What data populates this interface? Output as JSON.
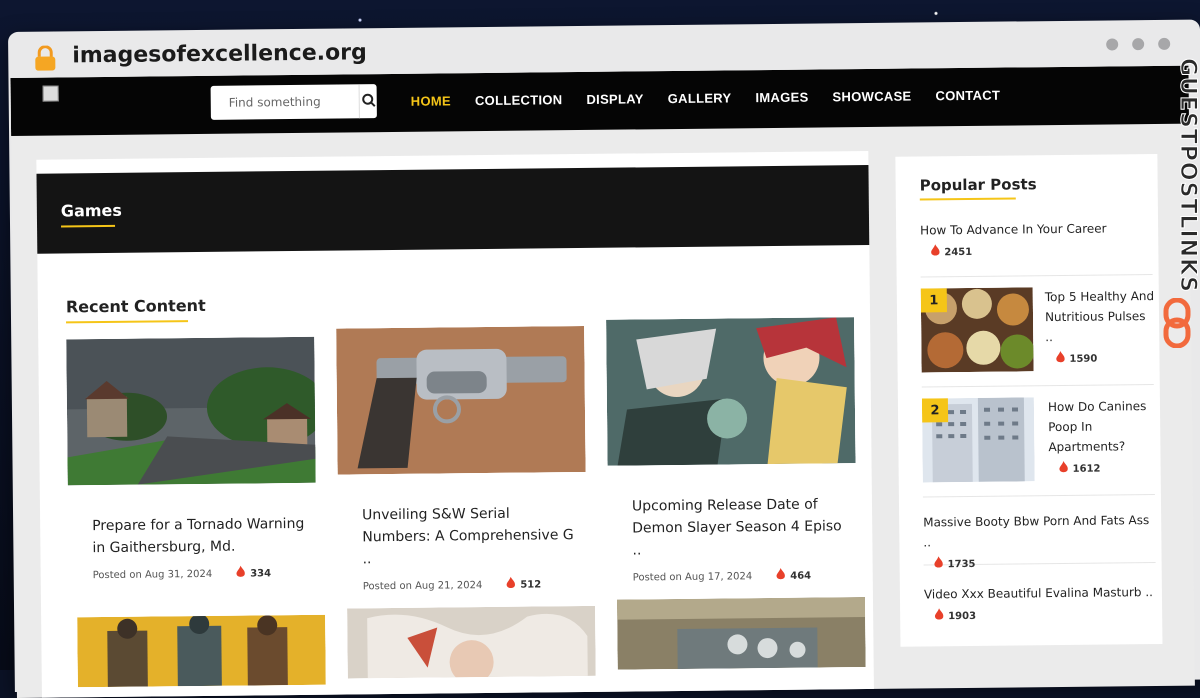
{
  "browser": {
    "url": "imagesofexcellence.org"
  },
  "nav": {
    "search_placeholder": "Find something",
    "items": [
      "HOME",
      "COLLECTION",
      "DISPLAY",
      "GALLERY",
      "IMAGES",
      "SHOWCASE",
      "CONTACT"
    ],
    "active": "HOME"
  },
  "main": {
    "category": "Games",
    "section_title": "Recent Content",
    "posts": [
      {
        "title": "Prepare for a Tornado Warning in Gaithersburg, Md.",
        "date": "Posted on Aug 31, 2024",
        "views": "334"
      },
      {
        "title": "Unveiling S&W Serial Numbers: A Comprehensive G ..",
        "date": "Posted on Aug 21, 2024",
        "views": "512"
      },
      {
        "title": "Upcoming Release Date of Demon Slayer Season 4 Episo ..",
        "date": "Posted on Aug 17, 2024",
        "views": "464"
      }
    ]
  },
  "sidebar": {
    "title": "Popular Posts",
    "items": [
      {
        "title": "How To Advance In Your Career",
        "views": "2451"
      },
      {
        "rank": "1",
        "title": "Top 5 Healthy And Nutritious Pulses ..",
        "views": "1590"
      },
      {
        "rank": "2",
        "title": "How Do Canines Poop In Apartments?",
        "views": "1612"
      },
      {
        "title": "Massive Booty Bbw Porn And Fats Ass ..",
        "views": "1735"
      },
      {
        "title": "Video Xxx Beautiful Evalina Masturb ..",
        "views": "1903"
      }
    ]
  },
  "badge": {
    "text": "GUESTPOSTLINKS"
  },
  "colors": {
    "accent": "#f5c518",
    "nav_bg": "#050505",
    "fire": "#e8402a"
  }
}
